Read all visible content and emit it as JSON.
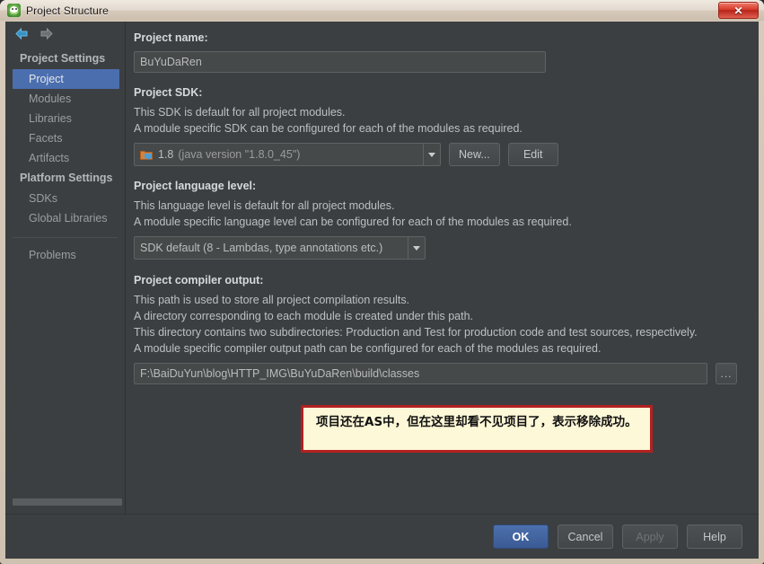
{
  "window": {
    "title": "Project Structure",
    "app_icon": "intellij-logo-icon",
    "close_label": "✕"
  },
  "toolbar": {
    "back_icon": "arrow-left-icon",
    "forward_icon": "arrow-right-icon"
  },
  "sidebar": {
    "groups": [
      {
        "label": "Project Settings",
        "items": [
          {
            "label": "Project",
            "selected": true
          },
          {
            "label": "Modules",
            "selected": false
          },
          {
            "label": "Libraries",
            "selected": false
          },
          {
            "label": "Facets",
            "selected": false
          },
          {
            "label": "Artifacts",
            "selected": false
          }
        ]
      },
      {
        "label": "Platform Settings",
        "items": [
          {
            "label": "SDKs",
            "selected": false
          },
          {
            "label": "Global Libraries",
            "selected": false
          }
        ]
      }
    ],
    "problems_label": "Problems"
  },
  "main": {
    "project_name": {
      "title": "Project name:",
      "value": "BuYuDaRen"
    },
    "project_sdk": {
      "title": "Project SDK:",
      "desc_line1": "This SDK is default for all project modules.",
      "desc_line2": "A module specific SDK can be configured for each of the modules as required.",
      "selected_name": "1.8",
      "selected_detail": "(java version \"1.8.0_45\")",
      "sdk_icon": "jdk-folder-icon",
      "new_button": "New...",
      "edit_button": "Edit"
    },
    "language_level": {
      "title": "Project language level:",
      "desc_line1": "This language level is default for all project modules.",
      "desc_line2": "A module specific language level can be configured for each of the modules as required.",
      "selected": "SDK default (8 - Lambdas, type annotations etc.)"
    },
    "compiler_output": {
      "title": "Project compiler output:",
      "desc_line1": "This path is used to store all project compilation results.",
      "desc_line2": "A directory corresponding to each module is created under this path.",
      "desc_line3": "This directory contains two subdirectories: Production and Test for production code and test sources, respectively.",
      "desc_line4": "A module specific compiler output path can be configured for each of the modules as required.",
      "path": "F:\\BaiDuYun\\blog\\HTTP_IMG\\BuYuDaRen\\build\\classes",
      "browse_button": "..."
    }
  },
  "annotation": {
    "text": "项目还在AS中，但在这里却看不见项目了，表示移除成功。",
    "border_color": "#b32020",
    "background_color": "#fdf8d7"
  },
  "buttons": {
    "ok": "OK",
    "cancel": "Cancel",
    "apply": "Apply",
    "help": "Help"
  },
  "colors": {
    "selection_blue": "#4b6eaf",
    "panel_background": "#3c3f41",
    "field_background": "#45494a",
    "frame_tan": "#d8cbbb"
  }
}
